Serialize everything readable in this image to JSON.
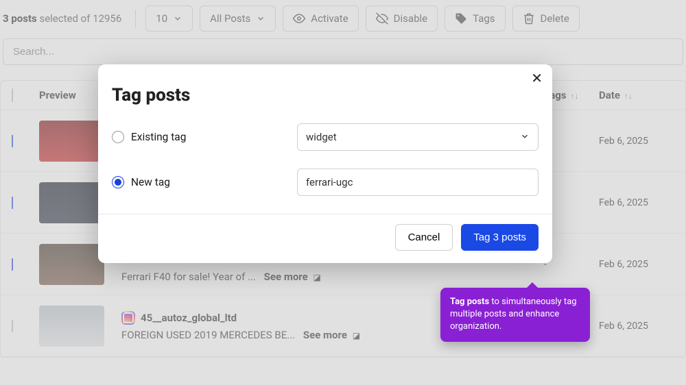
{
  "header": {
    "selected_count": "3 posts",
    "selected_suffix": " selected of 12956",
    "page_size": "10",
    "filter": "All Posts",
    "activate": "Activate",
    "disable": "Disable",
    "tags": "Tags",
    "delete": "Delete"
  },
  "search": {
    "placeholder": "Search..."
  },
  "columns": {
    "preview": "Preview",
    "tags": "Tags",
    "date": "Date"
  },
  "rows": [
    {
      "checked": true,
      "thumb": "red",
      "tags": "-",
      "date": "Feb 6, 2025"
    },
    {
      "checked": true,
      "thumb": "dark",
      "tags": "-",
      "date": "Feb 6, 2025"
    },
    {
      "checked": true,
      "thumb": "mech",
      "desc": "Ferrari F40 for sale! Year of ...",
      "see_more": "See more",
      "tags": "-",
      "date": "Feb 6, 2025"
    },
    {
      "checked": false,
      "thumb": "silver",
      "user": "45__autoz_global_ltd",
      "desc": "FOREIGN USED 2019 MERCEDES BE...",
      "see_more": "See more",
      "status_on": true,
      "tags": "-",
      "date": "Feb 6, 2025"
    }
  ],
  "modal": {
    "title": "Tag posts",
    "existing_label": "Existing tag",
    "existing_value": "widget",
    "new_label": "New tag",
    "new_value": "ferrari-ugc",
    "cancel": "Cancel",
    "submit": "Tag 3 posts"
  },
  "tooltip": {
    "bold": "Tag posts",
    "text": " to simultaneously tag multiple posts and enhance organization."
  }
}
